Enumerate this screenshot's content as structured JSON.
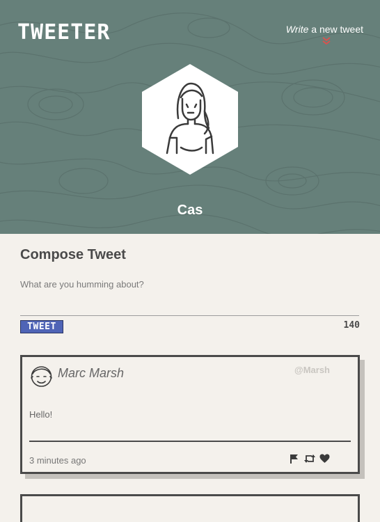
{
  "header": {
    "brand": "TWEETER",
    "write_link_italic": "Write",
    "write_link_rest": " a new tweet",
    "username": "Cas"
  },
  "compose": {
    "title": "Compose Tweet",
    "placeholder": "What are you humming about?",
    "button_label": "TWEET",
    "counter": "140"
  },
  "tweets": [
    {
      "author": "Marc Marsh",
      "handle": "@Marsh",
      "content": "Hello!",
      "time": "3 minutes ago",
      "actions": [
        "flag-icon",
        "retweet-icon",
        "heart-icon"
      ]
    }
  ],
  "colors": {
    "header_bg": "#66807a",
    "page_bg": "#f4f1ec",
    "tweet_button": "#4f64b6",
    "chevron": "#d9534f",
    "text_dark": "#4a4a4a"
  }
}
